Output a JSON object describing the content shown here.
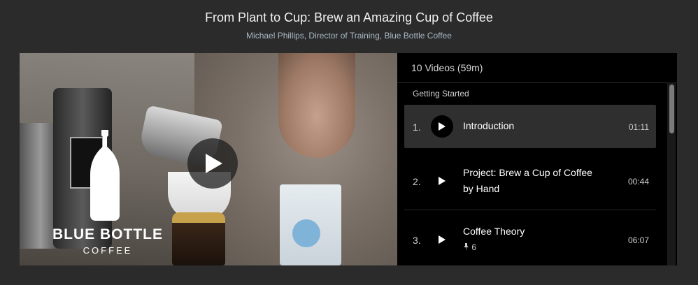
{
  "header": {
    "title": "From Plant to Cup: Brew an Amazing Cup of Coffee",
    "subtitle": "Michael Phillips, Director of Training, Blue Bottle Coffee"
  },
  "video": {
    "logo_text": "BLUE BOTTLE",
    "logo_sub": "COFFEE",
    "play_icon": "play-icon"
  },
  "playlist": {
    "summary": "10 Videos (59m)",
    "section": "Getting Started",
    "items": [
      {
        "num": "1.",
        "title": "Introduction",
        "time": "01:11",
        "active": true
      },
      {
        "num": "2.",
        "title": "Project: Brew a Cup of Coffee by Hand",
        "time": "00:44",
        "active": false
      },
      {
        "num": "3.",
        "title": "Coffee Theory",
        "time": "06:07",
        "active": false,
        "pin_count": "6"
      }
    ]
  }
}
